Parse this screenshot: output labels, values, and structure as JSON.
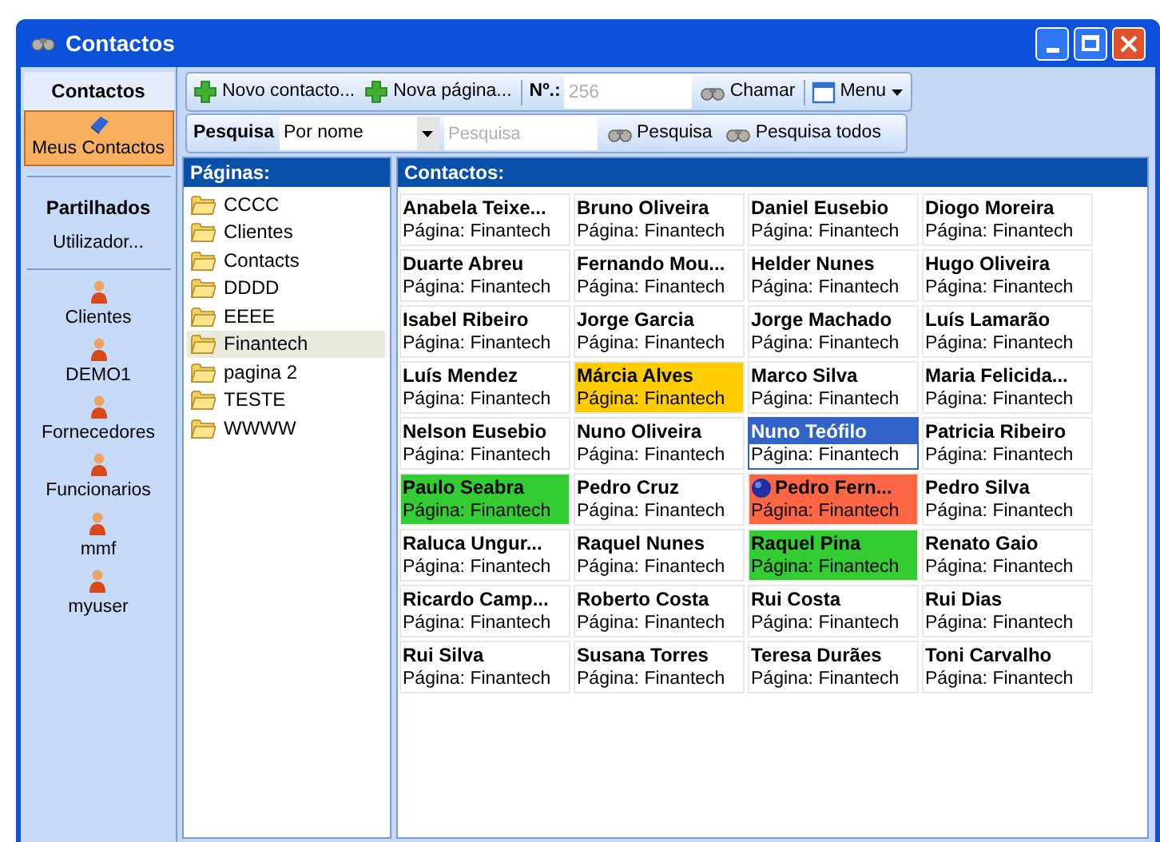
{
  "window": {
    "title": "Contactos"
  },
  "sidebar": {
    "header": "Contactos",
    "items": [
      {
        "label": "Meus Contactos",
        "selected": true
      }
    ],
    "shared_title": "Partilhados",
    "shared_subtitle": "Utilizador...",
    "users": [
      "Clientes",
      "DEMO1",
      "Fornecedores",
      "Funcionarios",
      "mmf",
      "myuser"
    ]
  },
  "toolbar": {
    "new_contact": "Novo contacto...",
    "new_page": "Nova página...",
    "number_label": "Nº.:",
    "number_placeholder": "256",
    "call": "Chamar",
    "menu": "Menu"
  },
  "search_bar": {
    "label": "Pesquisa",
    "mode": "Por nome",
    "placeholder": "Pesquisa",
    "search": "Pesquisa",
    "search_all": "Pesquisa todos"
  },
  "pages": {
    "title": "Páginas:",
    "items": [
      {
        "label": "CCCC",
        "selected": false
      },
      {
        "label": "Clientes",
        "selected": false
      },
      {
        "label": "Contacts",
        "selected": false
      },
      {
        "label": "DDDD",
        "selected": false
      },
      {
        "label": "EEEE",
        "selected": false
      },
      {
        "label": "Finantech",
        "selected": true
      },
      {
        "label": "pagina 2",
        "selected": false
      },
      {
        "label": "TESTE",
        "selected": false
      },
      {
        "label": "WWWW",
        "selected": false
      }
    ]
  },
  "contacts": {
    "title": "Contactos:",
    "items": [
      {
        "name": "Anabela Teixe...",
        "page": "Página: Finantech",
        "color": "#ffffff",
        "selected": false,
        "marked": false
      },
      {
        "name": "Bruno Oliveira",
        "page": "Página: Finantech",
        "color": "#ffffff",
        "selected": false,
        "marked": false
      },
      {
        "name": "Daniel Eusebio",
        "page": "Página: Finantech",
        "color": "#ffffff",
        "selected": false,
        "marked": false
      },
      {
        "name": "Diogo Moreira",
        "page": "Página: Finantech",
        "color": "#ffffff",
        "selected": false,
        "marked": false
      },
      {
        "name": "Duarte Abreu",
        "page": "Página: Finantech",
        "color": "#ffffff",
        "selected": false,
        "marked": false
      },
      {
        "name": "Fernando Mou...",
        "page": "Página: Finantech",
        "color": "#ffffff",
        "selected": false,
        "marked": false
      },
      {
        "name": "Helder Nunes",
        "page": "Página: Finantech",
        "color": "#ffffff",
        "selected": false,
        "marked": false
      },
      {
        "name": "Hugo Oliveira",
        "page": "Página: Finantech",
        "color": "#ffffff",
        "selected": false,
        "marked": false
      },
      {
        "name": "Isabel Ribeiro",
        "page": "Página: Finantech",
        "color": "#ffffff",
        "selected": false,
        "marked": false
      },
      {
        "name": "Jorge Garcia",
        "page": "Página: Finantech",
        "color": "#ffffff",
        "selected": false,
        "marked": false
      },
      {
        "name": "Jorge Machado",
        "page": "Página: Finantech",
        "color": "#ffffff",
        "selected": false,
        "marked": false
      },
      {
        "name": "Luís Lamarão",
        "page": "Página: Finantech",
        "color": "#ffffff",
        "selected": false,
        "marked": false
      },
      {
        "name": "Luís Mendez",
        "page": "Página: Finantech",
        "color": "#ffffff",
        "selected": false,
        "marked": false
      },
      {
        "name": "Márcia Alves",
        "page": "Página: Finantech",
        "color": "#ffcc00",
        "selected": false,
        "marked": false
      },
      {
        "name": "Marco Silva",
        "page": "Página: Finantech",
        "color": "#ffffff",
        "selected": false,
        "marked": false
      },
      {
        "name": "Maria Felicida...",
        "page": "Página: Finantech",
        "color": "#ffffff",
        "selected": false,
        "marked": false
      },
      {
        "name": "Nelson Eusebio",
        "page": "Página: Finantech",
        "color": "#ffffff",
        "selected": false,
        "marked": false
      },
      {
        "name": "Nuno Oliveira",
        "page": "Página: Finantech",
        "color": "#ffffff",
        "selected": false,
        "marked": false
      },
      {
        "name": "Nuno Teófilo",
        "page": "Página: Finantech",
        "color": "#ffffff",
        "selected": true,
        "marked": false
      },
      {
        "name": "Patricia Ribeiro",
        "page": "Página: Finantech",
        "color": "#ffffff",
        "selected": false,
        "marked": false
      },
      {
        "name": "Paulo Seabra",
        "page": "Página: Finantech",
        "color": "#33cc33",
        "selected": false,
        "marked": false
      },
      {
        "name": "Pedro Cruz",
        "page": "Página: Finantech",
        "color": "#ffffff",
        "selected": false,
        "marked": false
      },
      {
        "name": "Pedro Fern...",
        "page": "Página: Finantech",
        "color": "#ff6644",
        "selected": false,
        "marked": true
      },
      {
        "name": "Pedro Silva",
        "page": "Página: Finantech",
        "color": "#ffffff",
        "selected": false,
        "marked": false
      },
      {
        "name": "Raluca Ungur...",
        "page": "Página: Finantech",
        "color": "#ffffff",
        "selected": false,
        "marked": false
      },
      {
        "name": "Raquel Nunes",
        "page": "Página: Finantech",
        "color": "#ffffff",
        "selected": false,
        "marked": false
      },
      {
        "name": "Raquel Pina",
        "page": "Página: Finantech",
        "color": "#33cc33",
        "selected": false,
        "marked": false
      },
      {
        "name": "Renato Gaio",
        "page": "Página: Finantech",
        "color": "#ffffff",
        "selected": false,
        "marked": false
      },
      {
        "name": "Ricardo Camp...",
        "page": "Página: Finantech",
        "color": "#ffffff",
        "selected": false,
        "marked": false
      },
      {
        "name": "Roberto Costa",
        "page": "Página: Finantech",
        "color": "#ffffff",
        "selected": false,
        "marked": false
      },
      {
        "name": "Rui Costa",
        "page": "Página: Finantech",
        "color": "#ffffff",
        "selected": false,
        "marked": false
      },
      {
        "name": "Rui Dias",
        "page": "Página: Finantech",
        "color": "#ffffff",
        "selected": false,
        "marked": false
      },
      {
        "name": "Rui Silva",
        "page": "Página: Finantech",
        "color": "#ffffff",
        "selected": false,
        "marked": false
      },
      {
        "name": "Susana Torres",
        "page": "Página: Finantech",
        "color": "#ffffff",
        "selected": false,
        "marked": false
      },
      {
        "name": "Teresa Durães",
        "page": "Página: Finantech",
        "color": "#ffffff",
        "selected": false,
        "marked": false
      },
      {
        "name": "Toni Carvalho",
        "page": "Página: Finantech",
        "color": "#ffffff",
        "selected": false,
        "marked": false
      }
    ]
  }
}
